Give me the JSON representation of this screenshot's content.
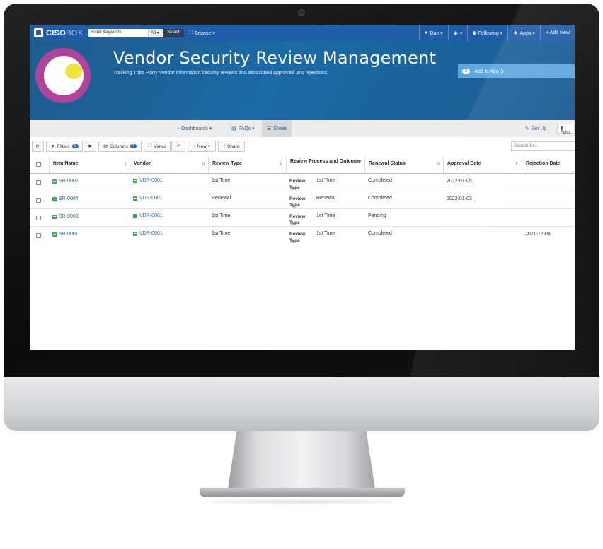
{
  "nav": {
    "logo_part1": "CISO",
    "logo_part2": "BOX",
    "search_placeholder": "Enter Keywords",
    "search_scope": "All ▾",
    "search_button": "Search",
    "browse": "Browse ▾",
    "user": "Dan ▾",
    "help": "▾",
    "following": "Following ▾",
    "apps": "Apps ▾",
    "add_new": "+ Add New"
  },
  "banner": {
    "title": "Vendor Security Review Management",
    "subtitle": "Tracking Third Party Vendor information security reviews and associated approvals and rejections.",
    "add_count": "3",
    "add_to_app": "Add to App ❯"
  },
  "subnav": {
    "dashboards": "Dashboards ▾",
    "faqs": "FAQs ▾",
    "sheet": "Sheet",
    "setup": "Set Up",
    "follow": "Follo"
  },
  "toolbar": {
    "filters": "Filters",
    "filters_count": "1",
    "clear": "✖",
    "columns": "Columns",
    "columns_count": "7",
    "views": "Views",
    "new": "+ New ▾",
    "share": "Share",
    "search_placeholder": "Search for..."
  },
  "table": {
    "headers": {
      "item_name": "Item Name",
      "vendor": "Vendor",
      "review_type": "Review Type",
      "review_process": "Review Process and Outcome",
      "renewal_status": "Renewal Status",
      "approval_date": "Approval Date",
      "rejection_date": "Rejection Date"
    },
    "review_type_label": "Review Type",
    "rows": [
      {
        "item": "SR-0002",
        "vendor": "VDR-0001",
        "review_type": "1st Time",
        "process_value": "1st Time",
        "renewal_status": "Completed",
        "approval_date": "2022-01-05",
        "rejection_date": ""
      },
      {
        "item": "SR-0004",
        "vendor": "VDR-0001",
        "review_type": "Renewal",
        "process_value": "Renewal",
        "renewal_status": "Completed",
        "approval_date": "2022-01-03",
        "rejection_date": ""
      },
      {
        "item": "SR-0003",
        "vendor": "VDR-0001",
        "review_type": "1st Time",
        "process_value": "1st Time",
        "renewal_status": "Pending",
        "approval_date": "",
        "rejection_date": ""
      },
      {
        "item": "SR-0001",
        "vendor": "VDR-0001",
        "review_type": "1st Time",
        "process_value": "1st Time",
        "renewal_status": "Completed",
        "approval_date": "",
        "rejection_date": "2021-12-08"
      }
    ]
  },
  "colors": {
    "nav_blue": "#1f5da8",
    "banner_blue": "#1a6aa6",
    "link_blue": "#2a67a5",
    "logo_purple": "#b1439a",
    "logo_yellow": "#f2e33a"
  }
}
